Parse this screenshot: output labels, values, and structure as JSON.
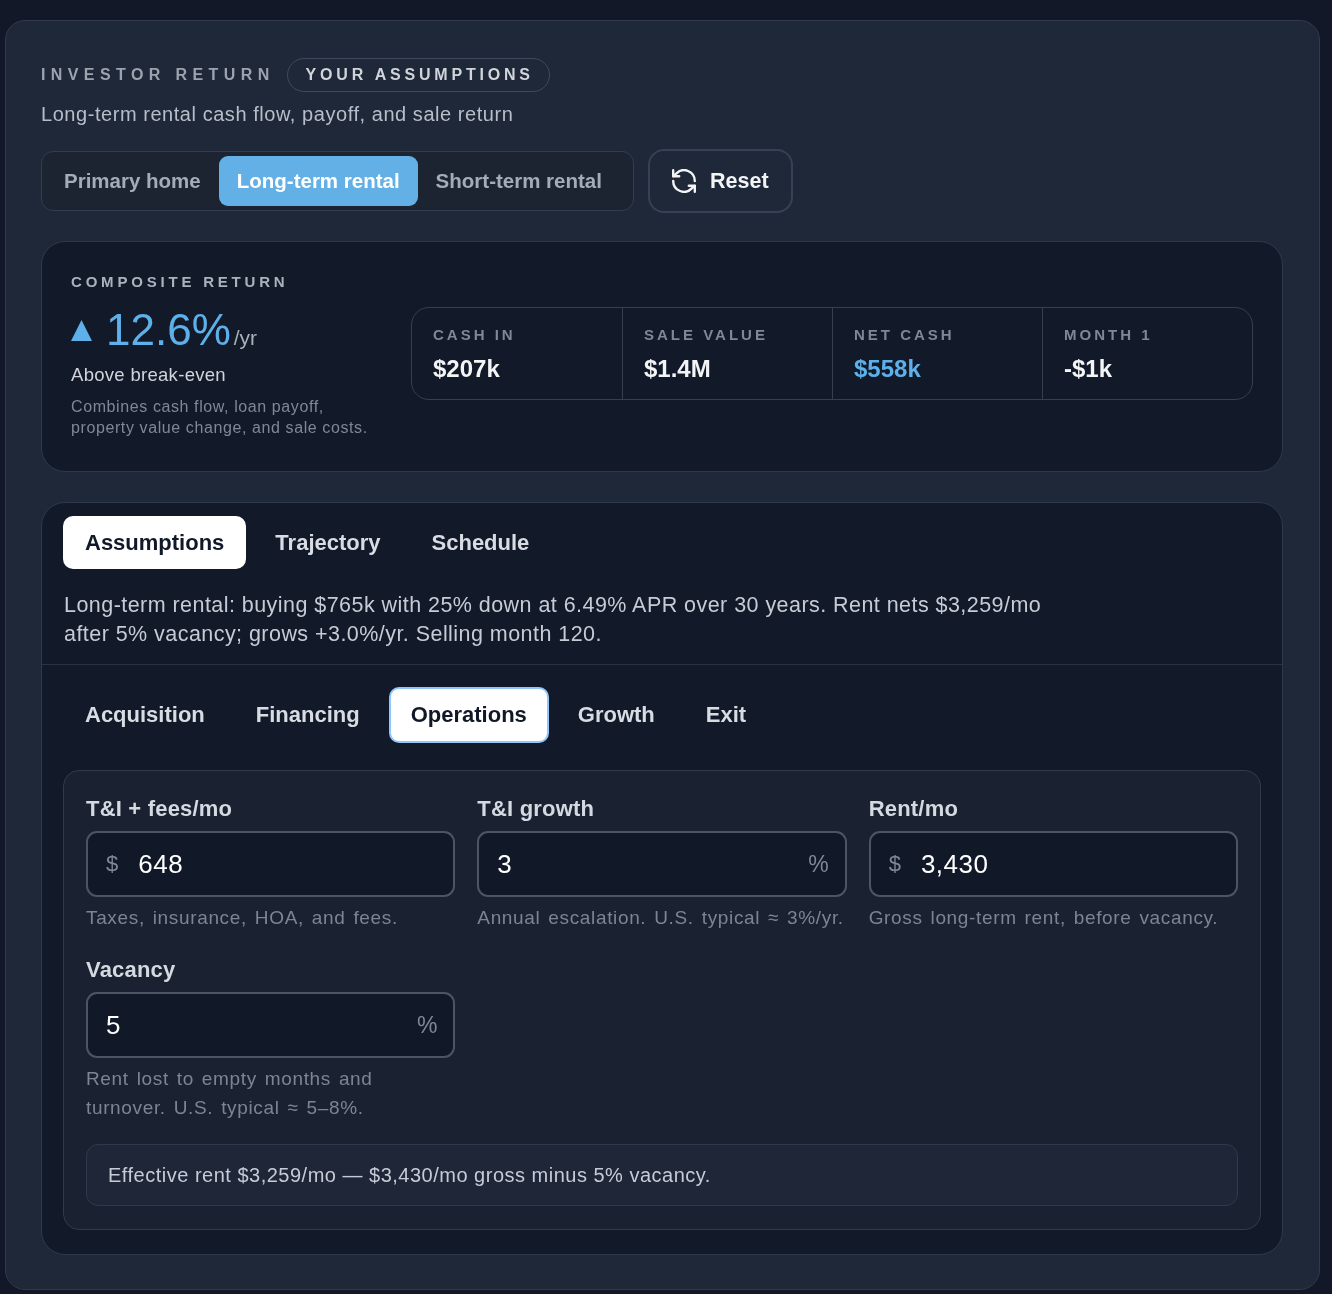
{
  "header": {
    "eyebrow": "INVESTOR RETURN",
    "badge": "YOUR ASSUMPTIONS",
    "subtitle": "Long-term rental cash flow, payoff, and sale return"
  },
  "modes": [
    {
      "label": "Primary home",
      "selected": false
    },
    {
      "label": "Long-term rental",
      "selected": true
    },
    {
      "label": "Short-term rental",
      "selected": false
    }
  ],
  "reset_button": {
    "label": "Reset"
  },
  "composite": {
    "label": "COMPOSITE RETURN",
    "trend_up": true,
    "value": "12.6%",
    "unit": "/yr",
    "status": "Above break-even",
    "note": "Combines cash flow, loan payoff, property value change, and sale costs.",
    "stats": [
      {
        "label": "CASH IN",
        "value": "$207k",
        "accent": false
      },
      {
        "label": "SALE VALUE",
        "value": "$1.4M",
        "accent": false
      },
      {
        "label": "NET CASH",
        "value": "$558k",
        "accent": true
      },
      {
        "label": "MONTH 1",
        "value": "-$1k",
        "accent": false
      }
    ]
  },
  "tabs": [
    {
      "label": "Assumptions",
      "selected": true
    },
    {
      "label": "Trajectory",
      "selected": false
    },
    {
      "label": "Schedule",
      "selected": false
    }
  ],
  "summary": "Long-term rental: buying $765k with 25% down at 6.49% APR over 30 years. Rent nets $3,259/mo after 5% vacancy; grows +3.0%/yr. Selling month 120.",
  "sections": [
    {
      "label": "Acquisition",
      "selected": false
    },
    {
      "label": "Financing",
      "selected": false
    },
    {
      "label": "Operations",
      "selected": true
    },
    {
      "label": "Growth",
      "selected": false
    },
    {
      "label": "Exit",
      "selected": false
    }
  ],
  "fields": [
    {
      "label": "T&I + fees/mo",
      "prefix": "$",
      "value": "648",
      "help": "Taxes, insurance, HOA, and fees."
    },
    {
      "label": "T&I growth",
      "value": "3",
      "suffix": "%",
      "help": "Annual escalation. U.S. typical ≈ 3%/yr."
    },
    {
      "label": "Rent/mo",
      "prefix": "$",
      "value": "3,430",
      "help": "Gross long-term rent, before vacancy."
    },
    {
      "label": "Vacancy",
      "value": "5",
      "suffix": "%",
      "help": "Rent lost to empty months and turnover. U.S. typical ≈ 5–8%."
    }
  ],
  "note": "Effective rent $3,259/mo — $3,430/mo gross minus 5% vacancy."
}
